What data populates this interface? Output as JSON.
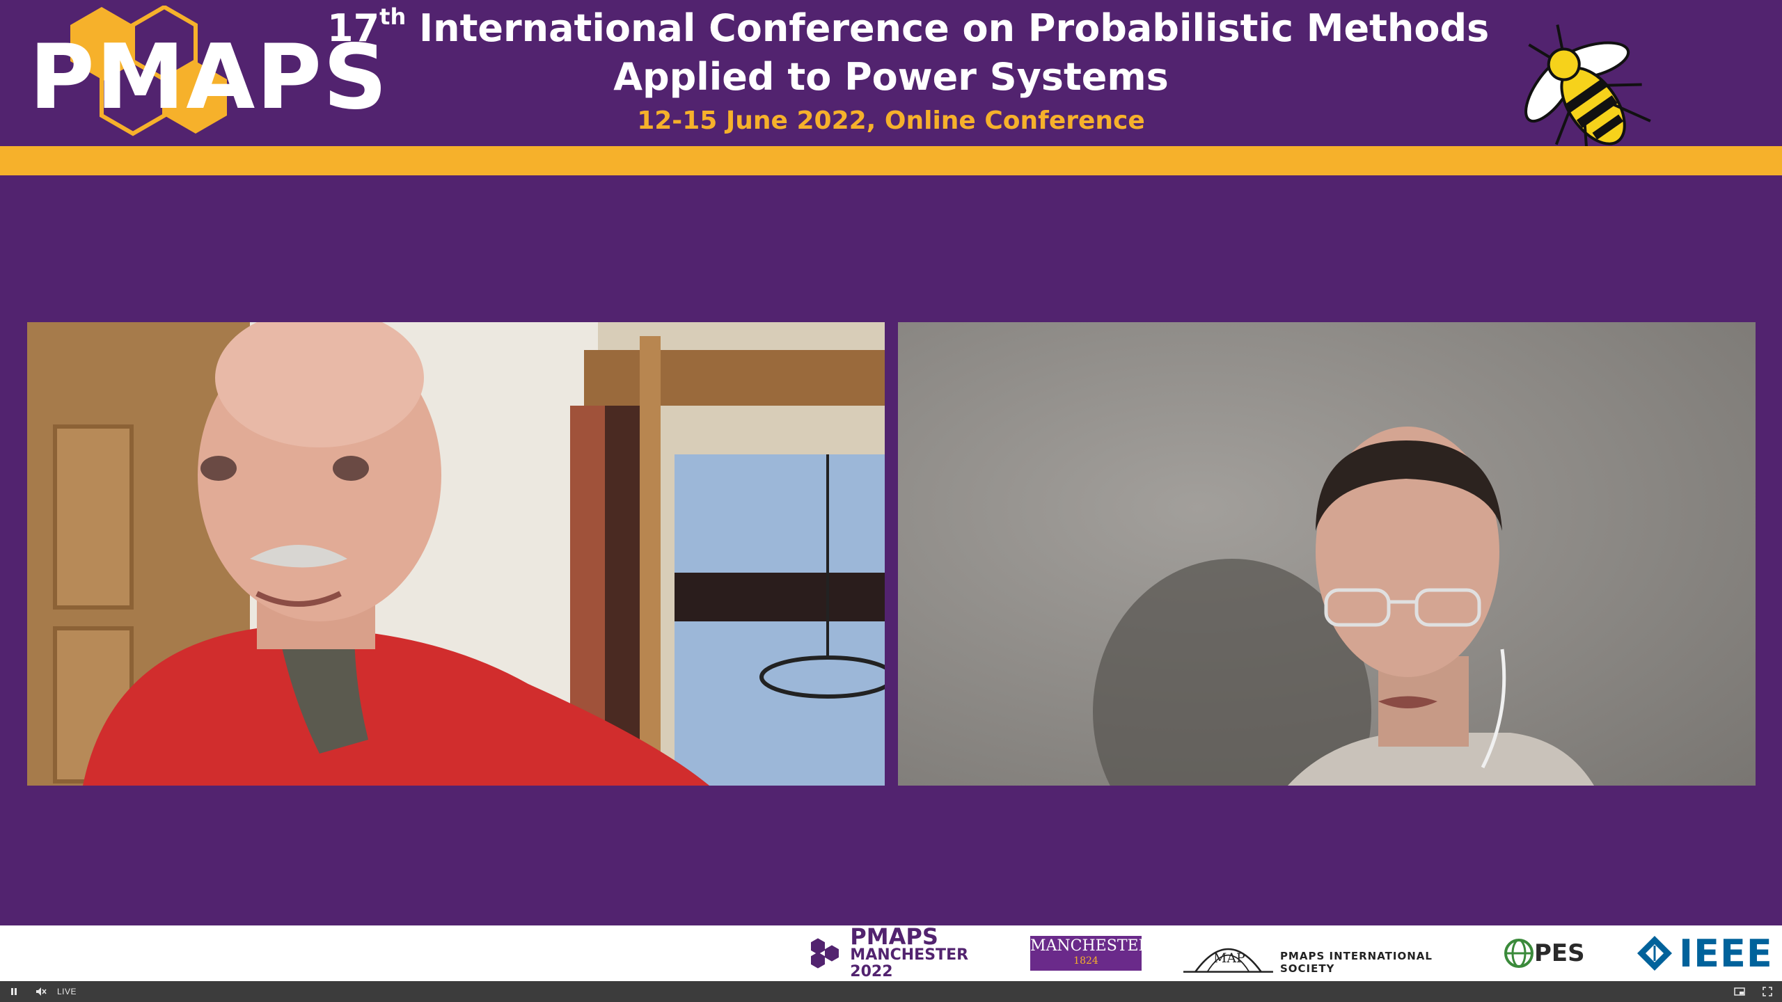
{
  "header": {
    "logo_text": "PMAPS",
    "title_ordinal": "17",
    "title_ordinal_suffix": "th",
    "title_line1_rest": " International Conference on Probabilistic Methods",
    "title_line2": "Applied to Power Systems",
    "title_line3": "12-15 June 2022, Online Conference"
  },
  "colors": {
    "background": "#52236f",
    "accent_gold": "#f6b12b",
    "text": "#ffffff",
    "ieee_blue": "#00629b"
  },
  "participants": [
    {
      "icon": "video-feed-participant-1"
    },
    {
      "icon": "video-feed-participant-2"
    }
  ],
  "sponsors": {
    "pmaps_name": "PMAPS",
    "pmaps_sub": "MANCHESTER 2022",
    "manchester_name": "MANCHESTER",
    "manchester_year": "1824",
    "society_text": "PMAPS INTERNATIONAL SOCIETY",
    "pes_text": "PES",
    "ieee_text": "IEEE"
  },
  "player": {
    "live_label": "LIVE",
    "icons": [
      "pause-icon",
      "muted-speaker-icon",
      "picture-in-picture-icon",
      "fullscreen-icon"
    ]
  }
}
